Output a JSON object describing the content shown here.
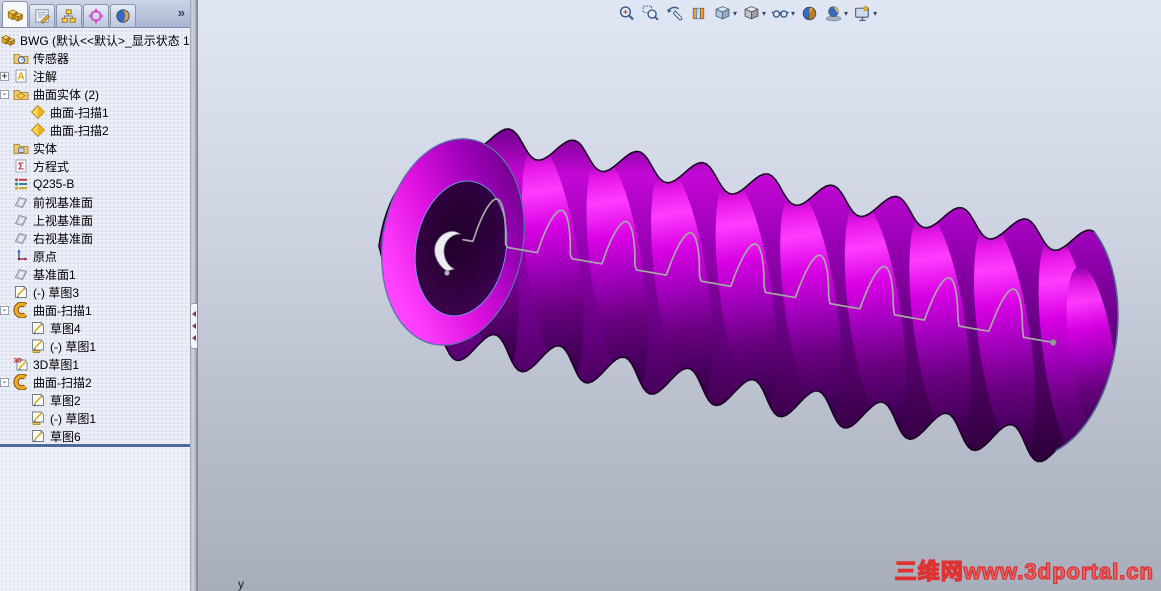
{
  "panel_tabs": {
    "tabs": [
      {
        "name": "featuremanager-tab",
        "icon": "tab-features",
        "active": true
      },
      {
        "name": "propertymanager-tab",
        "icon": "tab-properties",
        "active": false
      },
      {
        "name": "configurationmanager-tab",
        "icon": "tab-config",
        "active": false
      },
      {
        "name": "dimxpertmanager-tab",
        "icon": "tab-dimxpert",
        "active": false
      },
      {
        "name": "displaymanager-tab",
        "icon": "tab-display",
        "active": false
      }
    ],
    "overflow_label": "»"
  },
  "feature_tree": {
    "items": [
      {
        "label": "BWG  (默认<<默认>_显示状态 1",
        "icon": "part",
        "indent": 0,
        "expander": null
      },
      {
        "label": "传感器",
        "icon": "sensors-folder",
        "indent": 1,
        "expander": null
      },
      {
        "label": "注解",
        "icon": "annotations",
        "indent": 1,
        "expander": "+"
      },
      {
        "label": "曲面实体 (2)",
        "icon": "surface-folder",
        "indent": 1,
        "expander": "-"
      },
      {
        "label": "曲面-扫描1",
        "icon": "surface-sweep",
        "indent": 2,
        "expander": null
      },
      {
        "label": "曲面-扫描2",
        "icon": "surface-sweep",
        "indent": 2,
        "expander": null
      },
      {
        "label": "实体",
        "icon": "solid-folder",
        "indent": 1,
        "expander": null
      },
      {
        "label": "方程式",
        "icon": "equations",
        "indent": 1,
        "expander": null
      },
      {
        "label": "Q235-B",
        "icon": "material",
        "indent": 1,
        "expander": null
      },
      {
        "label": "前视基准面",
        "icon": "plane",
        "indent": 1,
        "expander": null
      },
      {
        "label": "上视基准面",
        "icon": "plane",
        "indent": 1,
        "expander": null
      },
      {
        "label": "右视基准面",
        "icon": "plane",
        "indent": 1,
        "expander": null
      },
      {
        "label": "原点",
        "icon": "origin",
        "indent": 1,
        "expander": null
      },
      {
        "label": "基准面1",
        "icon": "plane",
        "indent": 1,
        "expander": null
      },
      {
        "label": "(-) 草图3",
        "icon": "sketch",
        "indent": 1,
        "expander": null
      },
      {
        "label": "曲面-扫描1",
        "icon": "sweep-feature",
        "indent": 1,
        "expander": "-"
      },
      {
        "label": "草图4",
        "icon": "sketch",
        "indent": 2,
        "expander": null
      },
      {
        "label": "(-) 草图1",
        "icon": "sketch-shared",
        "indent": 2,
        "expander": null
      },
      {
        "label": "3D草图1",
        "icon": "sketch3d",
        "indent": 1,
        "expander": null
      },
      {
        "label": "曲面-扫描2",
        "icon": "sweep-feature",
        "indent": 1,
        "expander": "-"
      },
      {
        "label": "草图2",
        "icon": "sketch",
        "indent": 2,
        "expander": null
      },
      {
        "label": "(-) 草图1",
        "icon": "sketch-shared",
        "indent": 2,
        "expander": null
      },
      {
        "label": "草图6",
        "icon": "sketch",
        "indent": 2,
        "expander": null
      }
    ]
  },
  "viewport": {
    "toolbar": {
      "buttons": [
        {
          "name": "zoom-to-fit",
          "dropdown": false
        },
        {
          "name": "zoom-to-area",
          "dropdown": false
        },
        {
          "name": "previous-view",
          "dropdown": false
        },
        {
          "name": "section-view",
          "dropdown": false
        },
        {
          "name": "view-orientation",
          "dropdown": true
        },
        {
          "name": "display-style",
          "dropdown": true
        },
        {
          "name": "hide-show-items",
          "dropdown": true
        },
        {
          "name": "edit-appearance",
          "dropdown": false
        },
        {
          "name": "apply-scene",
          "dropdown": true
        },
        {
          "name": "view-settings",
          "dropdown": true
        }
      ]
    },
    "watermark": "三维网www.3dportal.cn",
    "triad_label": "y"
  },
  "colors": {
    "model_magenta": "#ff3cff",
    "model_purple": "#8a00a8",
    "model_dark": "#2c0038",
    "edge_blue": "#7aa8f0",
    "sketch_path_gray": "#a8a8a8",
    "watermark_red": "#dd3333"
  }
}
